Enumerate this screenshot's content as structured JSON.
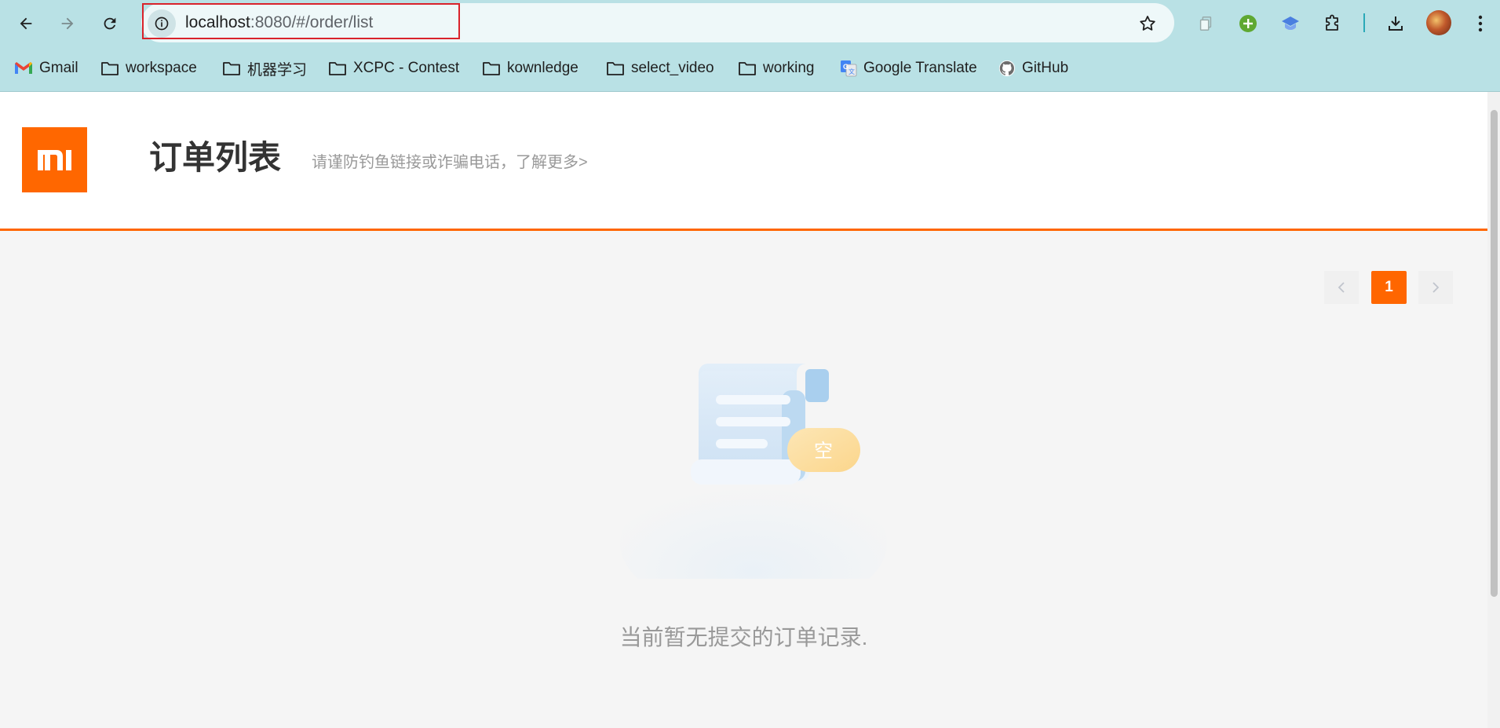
{
  "browser": {
    "url_host": "localhost",
    "url_rest": ":8080/#/order/list",
    "bookmarks": [
      {
        "label": "Gmail",
        "icon": "gmail-icon"
      },
      {
        "label": "workspace",
        "icon": "folder-icon"
      },
      {
        "label": "机器学习",
        "icon": "folder-icon"
      },
      {
        "label": "XCPC - Contest",
        "icon": "folder-icon"
      },
      {
        "label": "kownledge",
        "icon": "folder-icon"
      },
      {
        "label": "select_video",
        "icon": "folder-icon"
      },
      {
        "label": "working",
        "icon": "folder-icon"
      },
      {
        "label": "Google Translate",
        "icon": "google-translate-icon"
      },
      {
        "label": "GitHub",
        "icon": "github-icon"
      }
    ],
    "colors": {
      "toolbar": "#b9e1e5",
      "url_highlight": "#d9232b"
    }
  },
  "page": {
    "logo_text": "mi",
    "title": "订单列表",
    "tip": "请谨防钓鱼链接或诈骗电话，了解更多>",
    "pagination": {
      "current": "1"
    },
    "empty": {
      "badge": "空",
      "message": "当前暂无提交的订单记录."
    },
    "colors": {
      "accent": "#ff6600"
    }
  }
}
